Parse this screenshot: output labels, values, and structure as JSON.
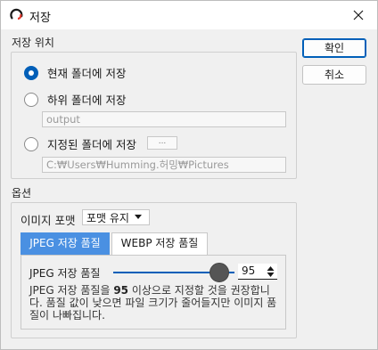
{
  "window": {
    "title": "저장",
    "close_icon": "close-icon",
    "app_icon": "app-logo-icon"
  },
  "save_location": {
    "group_title": "저장 위치",
    "options": [
      {
        "label": "현재 폴더에 저장",
        "selected": true
      },
      {
        "label": "하위 폴더에 저장",
        "selected": false
      },
      {
        "label": "지정된 폴더에 저장",
        "selected": false
      }
    ],
    "subfolder_value": "output",
    "browse_label": "...",
    "folder_path_value": "C:₩Users₩Humming.허밍₩Pictures"
  },
  "buttons": {
    "ok": "확인",
    "cancel": "취소"
  },
  "options": {
    "group_title": "옵션",
    "image_format_label": "이미지 포맷",
    "image_format_value": "포맷 유지",
    "tabs": [
      {
        "label": "JPEG 저장 품질",
        "active": true
      },
      {
        "label": "WEBP 저장 품질",
        "active": false
      }
    ],
    "quality_label": "JPEG 저장 품질",
    "quality_value": "95",
    "quality_fraction": 0.95,
    "desc_part1": "JPEG 저장 품질을 ",
    "desc_bold": "95",
    "desc_part2": " 이상으로 지정할 것을 권장합니다. 품질 값이 낮으면 파일 크기가 줄어들지만 이미지 품질이 나빠집니다."
  },
  "colors": {
    "accent": "#005fb8",
    "active_tab": "#4a90e2",
    "background": "#f0f0f0"
  }
}
